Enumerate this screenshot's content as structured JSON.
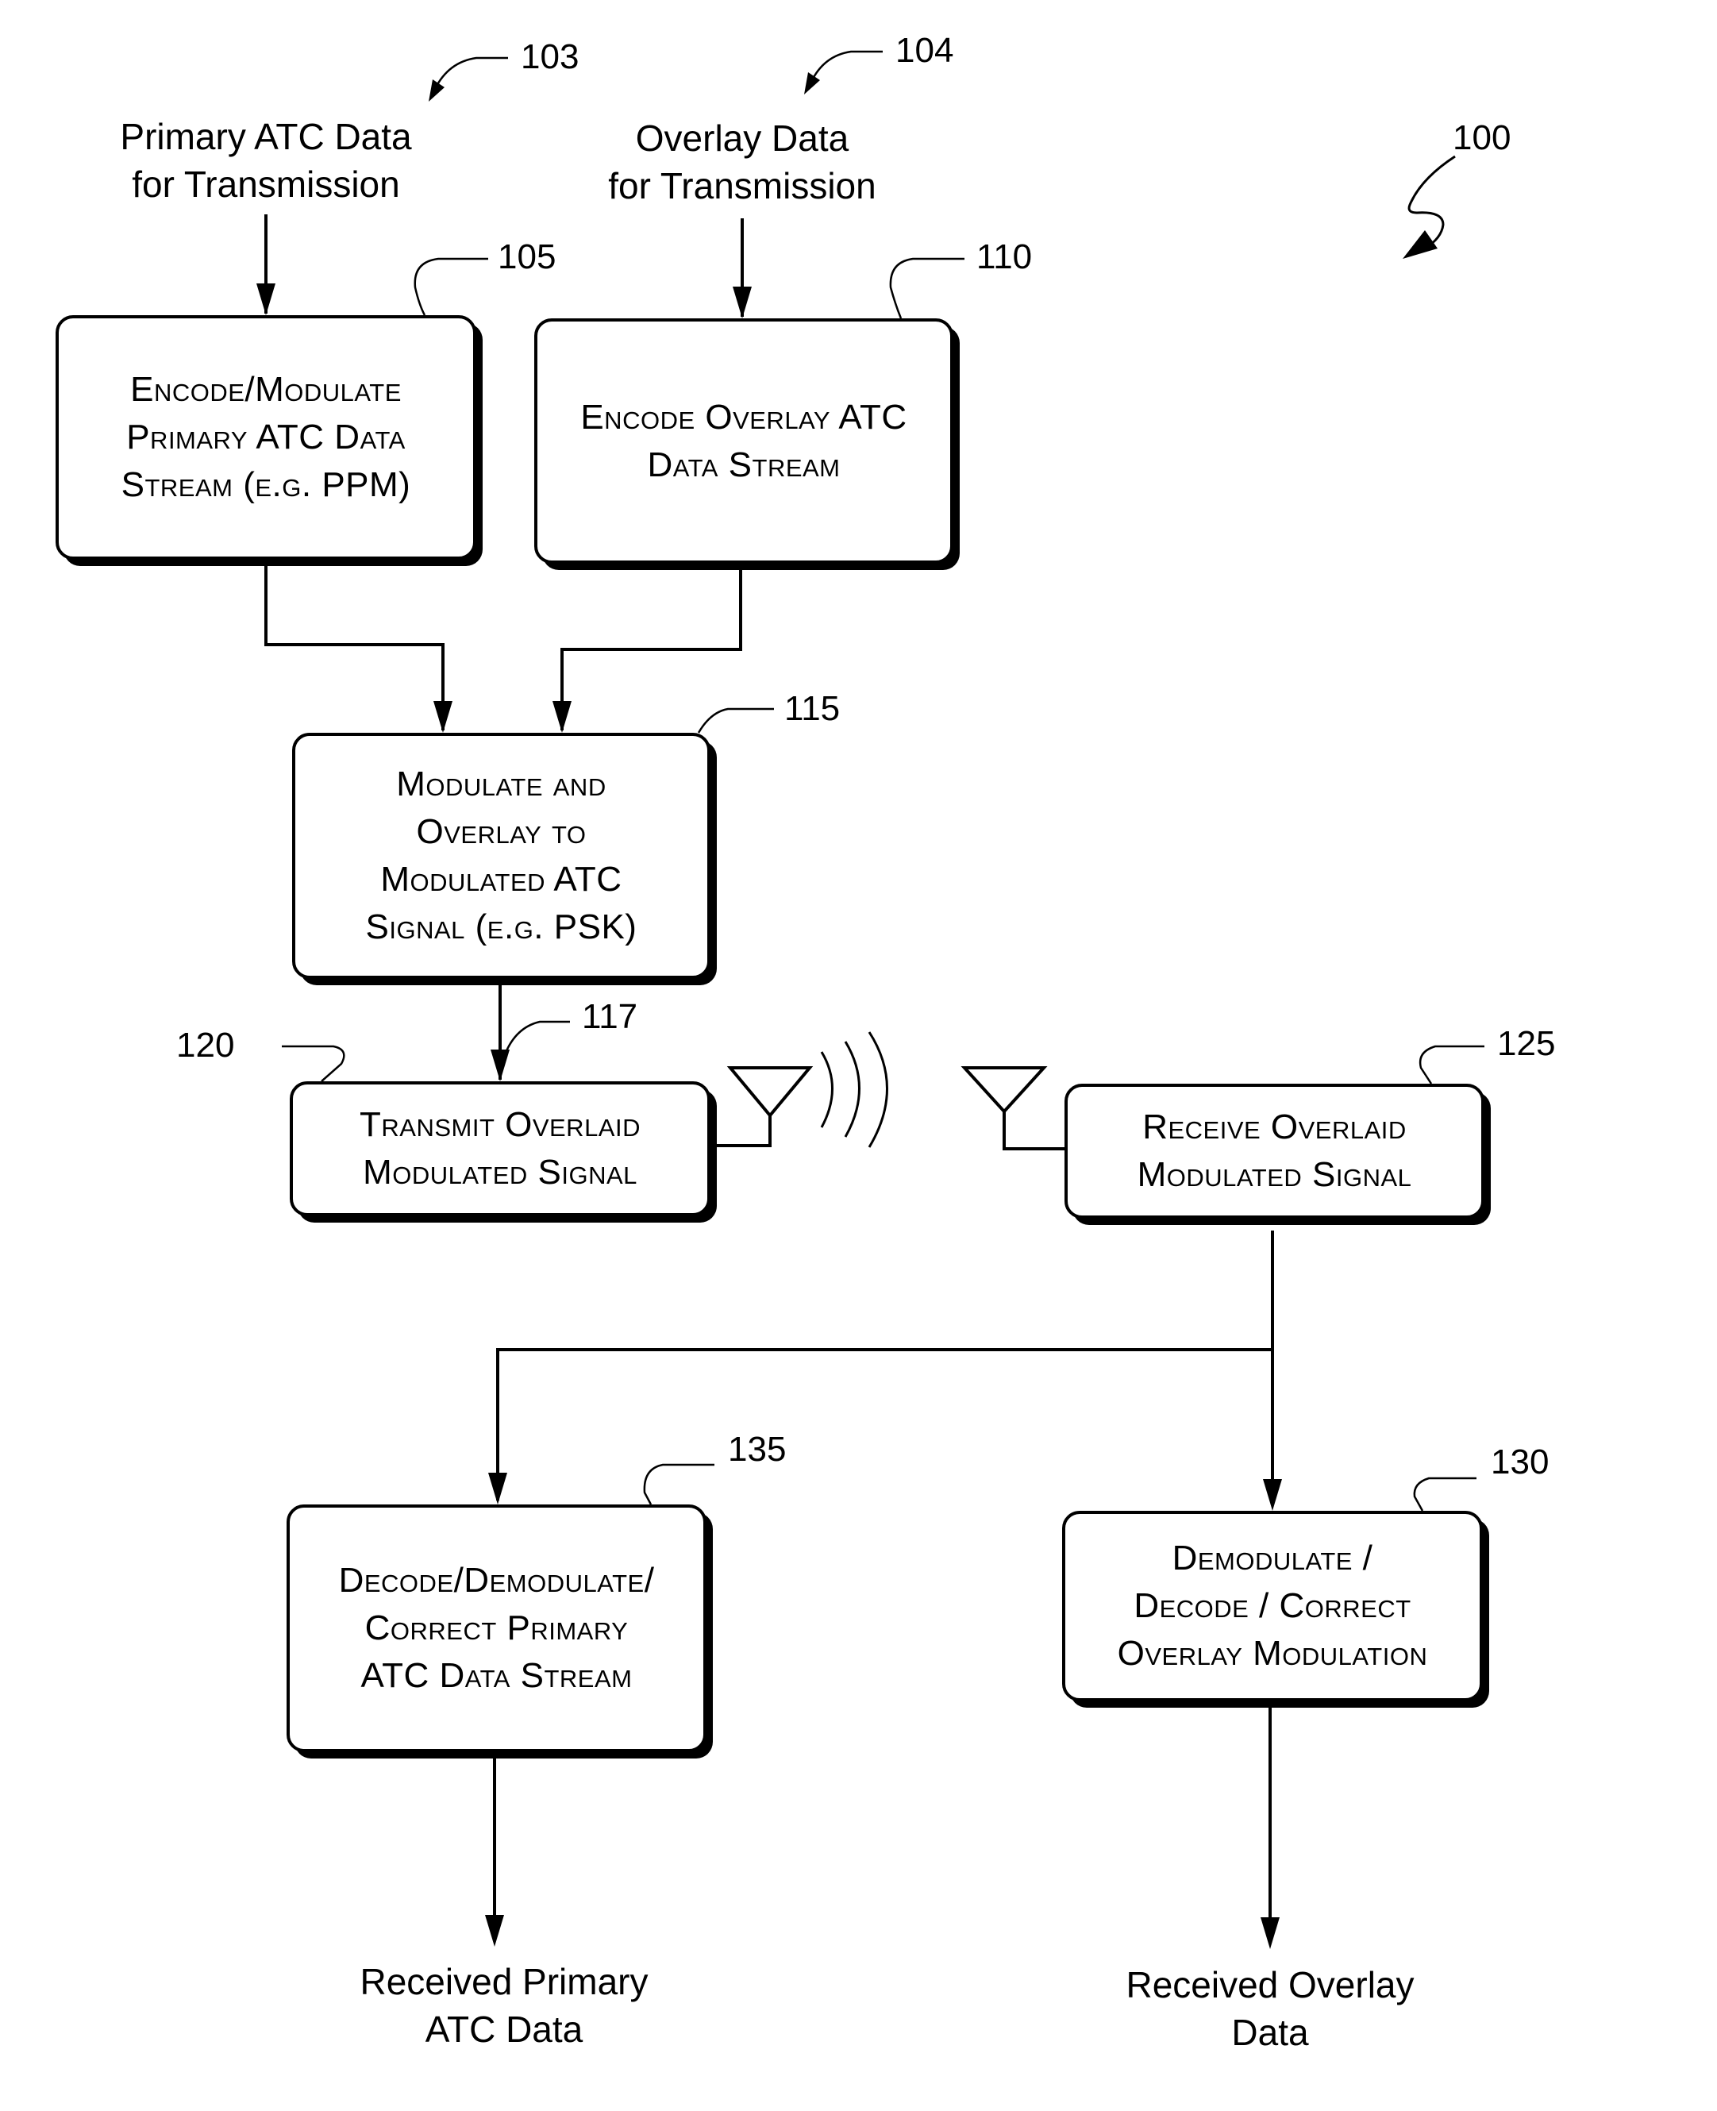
{
  "figure": {
    "ref": "100",
    "inputs": [
      {
        "ref": "103",
        "text": "Primary ATC Data\nfor Transmission"
      },
      {
        "ref": "104",
        "text": "Overlay Data\nfor Transmission"
      }
    ],
    "blocks": {
      "encode_primary": {
        "ref": "105",
        "text": "Encode/Modulate\nPrimary ATC Data\nStream (e.g. PPM)"
      },
      "encode_overlay": {
        "ref": "110",
        "text": "Encode Overlay ATC\nData Stream"
      },
      "modulate_overlay": {
        "ref": "115",
        "text": "Modulate and\nOverlay to\nModulated ATC\nSignal (e.g. PSK)"
      },
      "transmit": {
        "ref": "120",
        "text": "Transmit Overlaid\nModulated Signal"
      },
      "receive": {
        "ref": "125",
        "text": "Receive Overlaid\nModulated Signal"
      },
      "decode_overlay": {
        "ref": "130",
        "text": "Demodulate /\nDecode / Correct\nOverlay Modulation"
      },
      "decode_primary": {
        "ref": "135",
        "text": "Decode/Demodulate/\nCorrect Primary\nATC Data Stream"
      }
    },
    "signal_ref": "117",
    "outputs": [
      {
        "text": "Received Primary\nATC Data"
      },
      {
        "text": "Received Overlay\nData"
      }
    ],
    "icons": {
      "tx_antenna": "antenna-icon",
      "tx_waves": "radio-waves-icon",
      "rx_antenna": "antenna-icon"
    }
  }
}
